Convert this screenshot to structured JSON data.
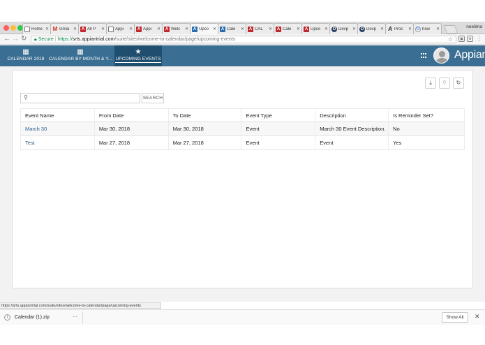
{
  "browser": {
    "tabs": [
      {
        "title": "Home",
        "favicon": "doc"
      },
      {
        "title": "Gmai",
        "favicon": "gmail"
      },
      {
        "title": "All P",
        "favicon": "appian"
      },
      {
        "title": "Appi",
        "favicon": "doc"
      },
      {
        "title": "Appi",
        "favicon": "appian"
      },
      {
        "title": "Welc",
        "favicon": "appian"
      },
      {
        "title": "Upco",
        "favicon": "appian-blue",
        "active": true
      },
      {
        "title": "Cale",
        "favicon": "appian-blue"
      },
      {
        "title": "CAL",
        "favicon": "appian"
      },
      {
        "title": "Cale",
        "favicon": "appian"
      },
      {
        "title": "Upco",
        "favicon": "appian"
      },
      {
        "title": "Devp",
        "favicon": "circle"
      },
      {
        "title": "Devp",
        "favicon": "circle"
      },
      {
        "title": "Proc",
        "favicon": "p"
      },
      {
        "title": "how",
        "favicon": "google"
      }
    ],
    "profile_name": "neelima",
    "secure_label": "Secure",
    "url_scheme": "https://",
    "url_host": "srts.appiantrial.com",
    "url_path": "/suite/sites/welcome-to-calendar/page/upcoming-events",
    "status_url": "https://srts.appiantrial.com/suite/sites/welcome-to-calendar/page/upcoming-events"
  },
  "app": {
    "brand": "Appian",
    "nav_tabs": [
      {
        "label": "CALENDAR 2018",
        "icon": "calendar-icon"
      },
      {
        "label": "CALENDAR BY MONTH & Y...",
        "icon": "calendar-icon"
      },
      {
        "label": "UPCOMING EVENTS",
        "icon": "star-icon",
        "active": true
      }
    ],
    "header_color": "#3a6e92",
    "active_tab_color": "#1f4e6e"
  },
  "grid": {
    "search_placeholder": "",
    "search_button": "SEARCH",
    "columns": [
      "Event Name",
      "From Date",
      "To Date",
      "Event Type",
      "Description",
      "Is Reminder Set?"
    ],
    "rows": [
      [
        "March 30",
        "Mar 30, 2018",
        "Mar 30, 2018",
        "Event",
        "March 30 Event Description.",
        "No"
      ],
      [
        "Test",
        "Mar 27, 2018",
        "Mar 27, 2018",
        "Event",
        "Event",
        "Yes"
      ]
    ]
  },
  "downloads": {
    "file_name": "Calendar (1).zip",
    "more": "...",
    "show_all": "Show All"
  }
}
